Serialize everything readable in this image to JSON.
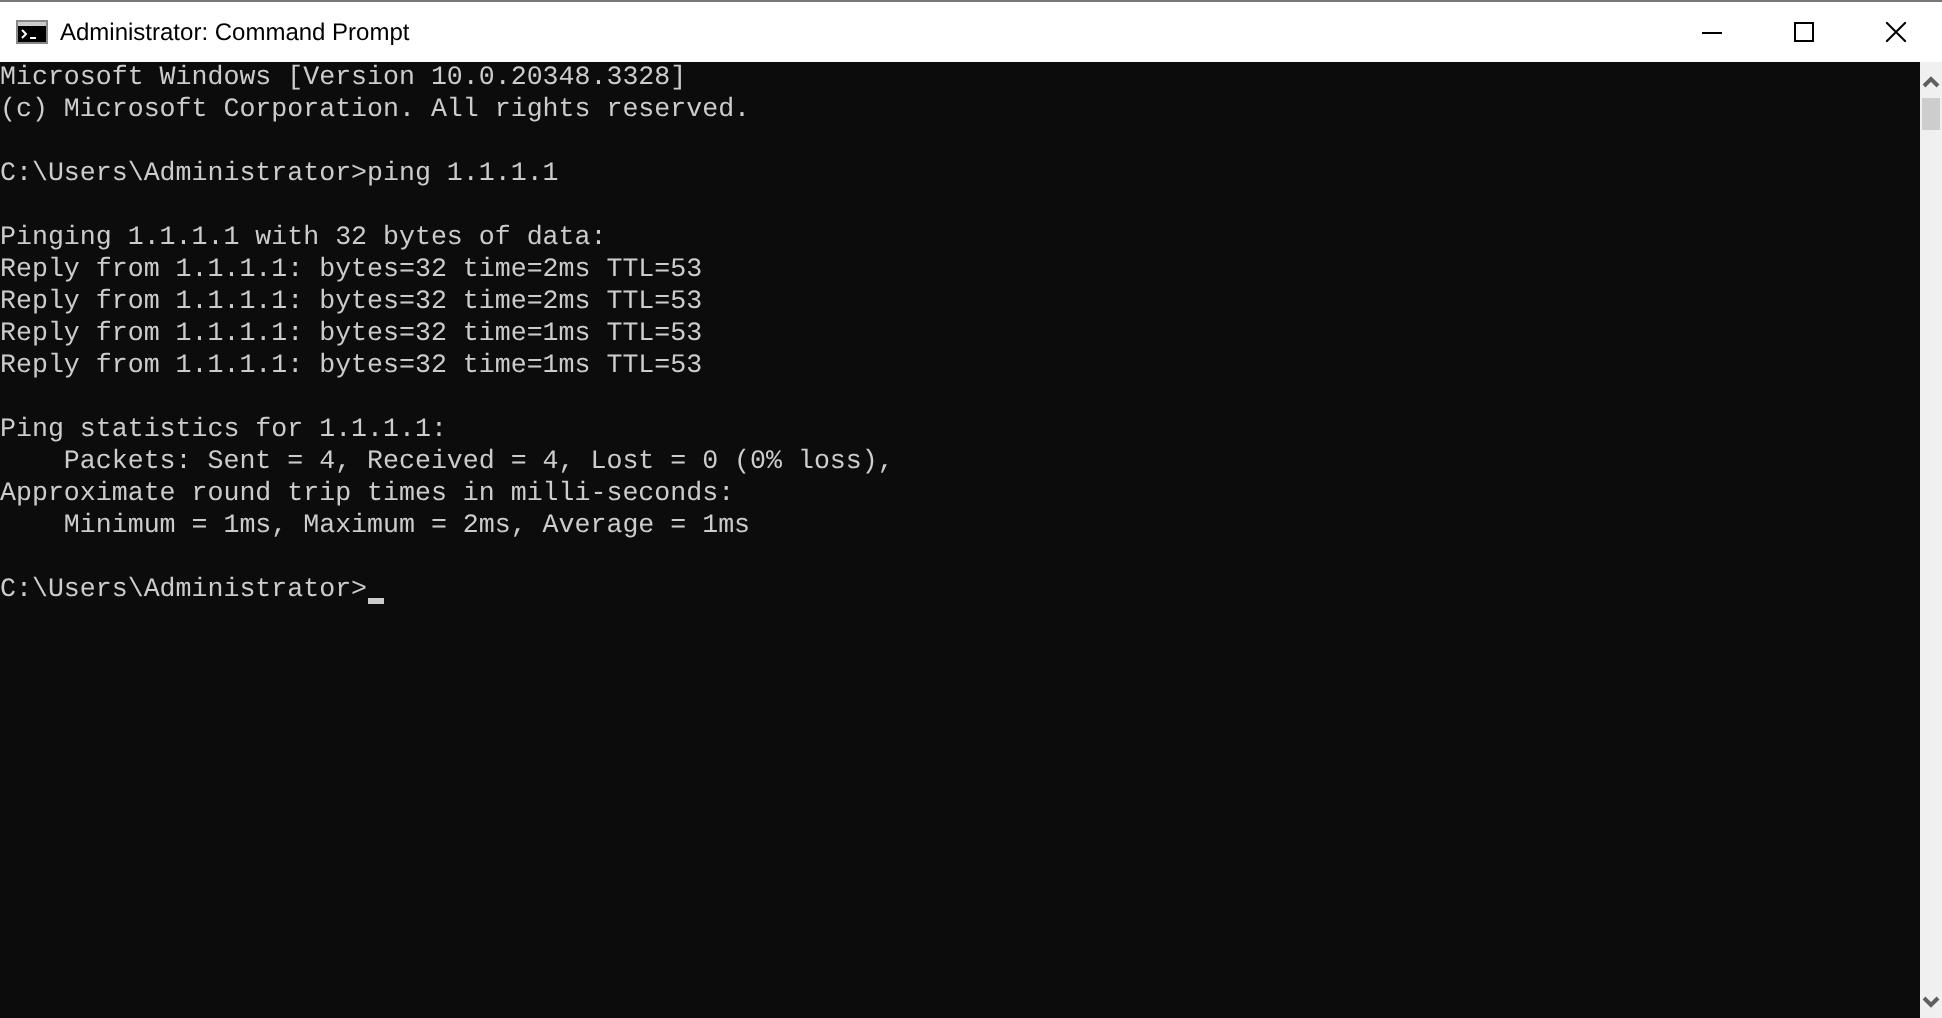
{
  "window": {
    "title": "Administrator: Command Prompt"
  },
  "console": {
    "blocks": [
      [
        "Microsoft Windows [Version 10.0.20348.3328]",
        "(c) Microsoft Corporation. All rights reserved."
      ],
      [
        "C:\\Users\\Administrator>ping 1.1.1.1"
      ],
      [
        "Pinging 1.1.1.1 with 32 bytes of data:",
        "Reply from 1.1.1.1: bytes=32 time=2ms TTL=53",
        "Reply from 1.1.1.1: bytes=32 time=2ms TTL=53",
        "Reply from 1.1.1.1: bytes=32 time=1ms TTL=53",
        "Reply from 1.1.1.1: bytes=32 time=1ms TTL=53"
      ],
      [
        "Ping statistics for 1.1.1.1:",
        "    Packets: Sent = 4, Received = 4, Lost = 0 (0% loss),",
        "Approximate round trip times in milli-seconds:",
        "    Minimum = 1ms, Maximum = 2ms, Average = 1ms"
      ]
    ],
    "prompt": "C:\\Users\\Administrator>"
  }
}
